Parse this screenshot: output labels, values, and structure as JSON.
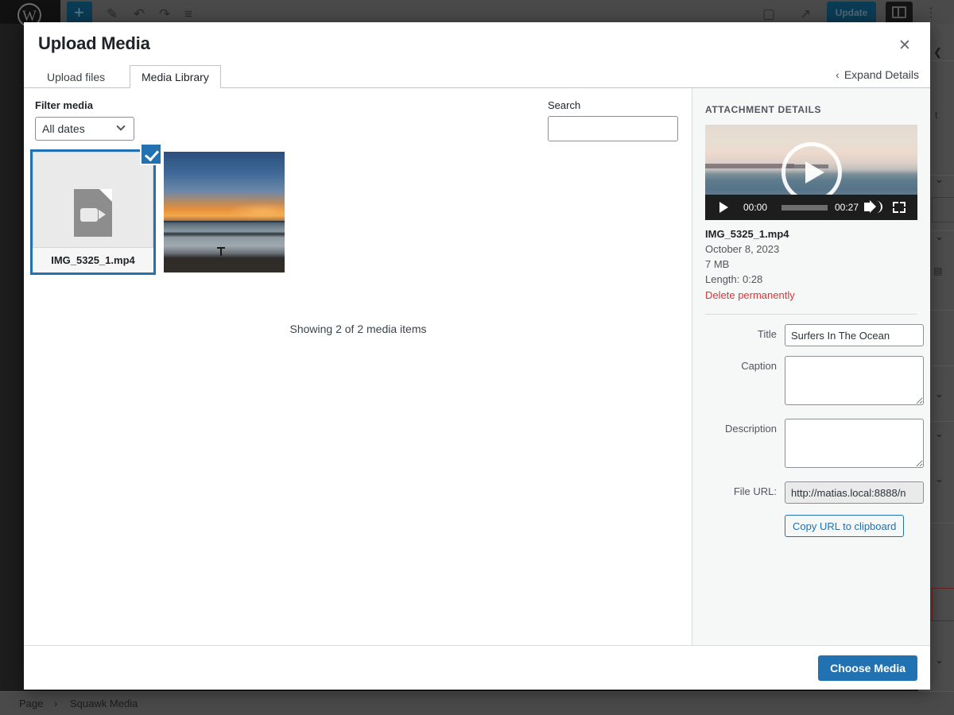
{
  "background": {
    "toolbar": {
      "update_label": "Update",
      "icons": [
        "wordpress-logo-icon",
        "add-block-icon",
        "pencil-icon",
        "undo-icon",
        "redo-icon",
        "list-view-icon",
        "desktop-icon",
        "external-link-icon",
        "sidebar-toggle-icon",
        "options-kebab-icon"
      ]
    },
    "breadcrumb": {
      "items": [
        "Page",
        "Squawk Media"
      ],
      "separator": "›"
    }
  },
  "modal": {
    "title": "Upload Media",
    "close_label": "✕",
    "tabs": [
      {
        "label": "Upload files",
        "active": false
      },
      {
        "label": "Media Library",
        "active": true
      }
    ],
    "expand_details": {
      "chevron": "‹",
      "label": "Expand Details"
    },
    "filter": {
      "label": "Filter media",
      "selected": "All dates"
    },
    "search": {
      "label": "Search",
      "value": "",
      "placeholder": ""
    },
    "attachments": [
      {
        "type": "video-file",
        "filename": "IMG_5325_1.mp4",
        "selected": true
      },
      {
        "type": "image",
        "filename": "",
        "selected": false
      }
    ],
    "showing_count": "Showing 2 of 2 media items",
    "sidebar": {
      "heading": "ATTACHMENT DETAILS",
      "player": {
        "current_time": "00:00",
        "duration": "00:27"
      },
      "filename": "IMG_5325_1.mp4",
      "date": "October 8, 2023",
      "filesize": "7 MB",
      "length": "Length: 0:28",
      "delete_label": "Delete permanently",
      "fields": {
        "title_label": "Title",
        "title_value": "Surfers In The Ocean",
        "caption_label": "Caption",
        "caption_value": "",
        "description_label": "Description",
        "description_value": "",
        "file_url_label": "File URL:",
        "file_url_value": "http://matias.local:8888/n",
        "copy_label": "Copy URL to clipboard"
      }
    },
    "footer": {
      "choose_label": "Choose Media"
    }
  },
  "colors": {
    "accent": "#2271b1",
    "danger": "#d63638",
    "panel_bg": "#f6f7f7",
    "border": "#8c8f94"
  }
}
